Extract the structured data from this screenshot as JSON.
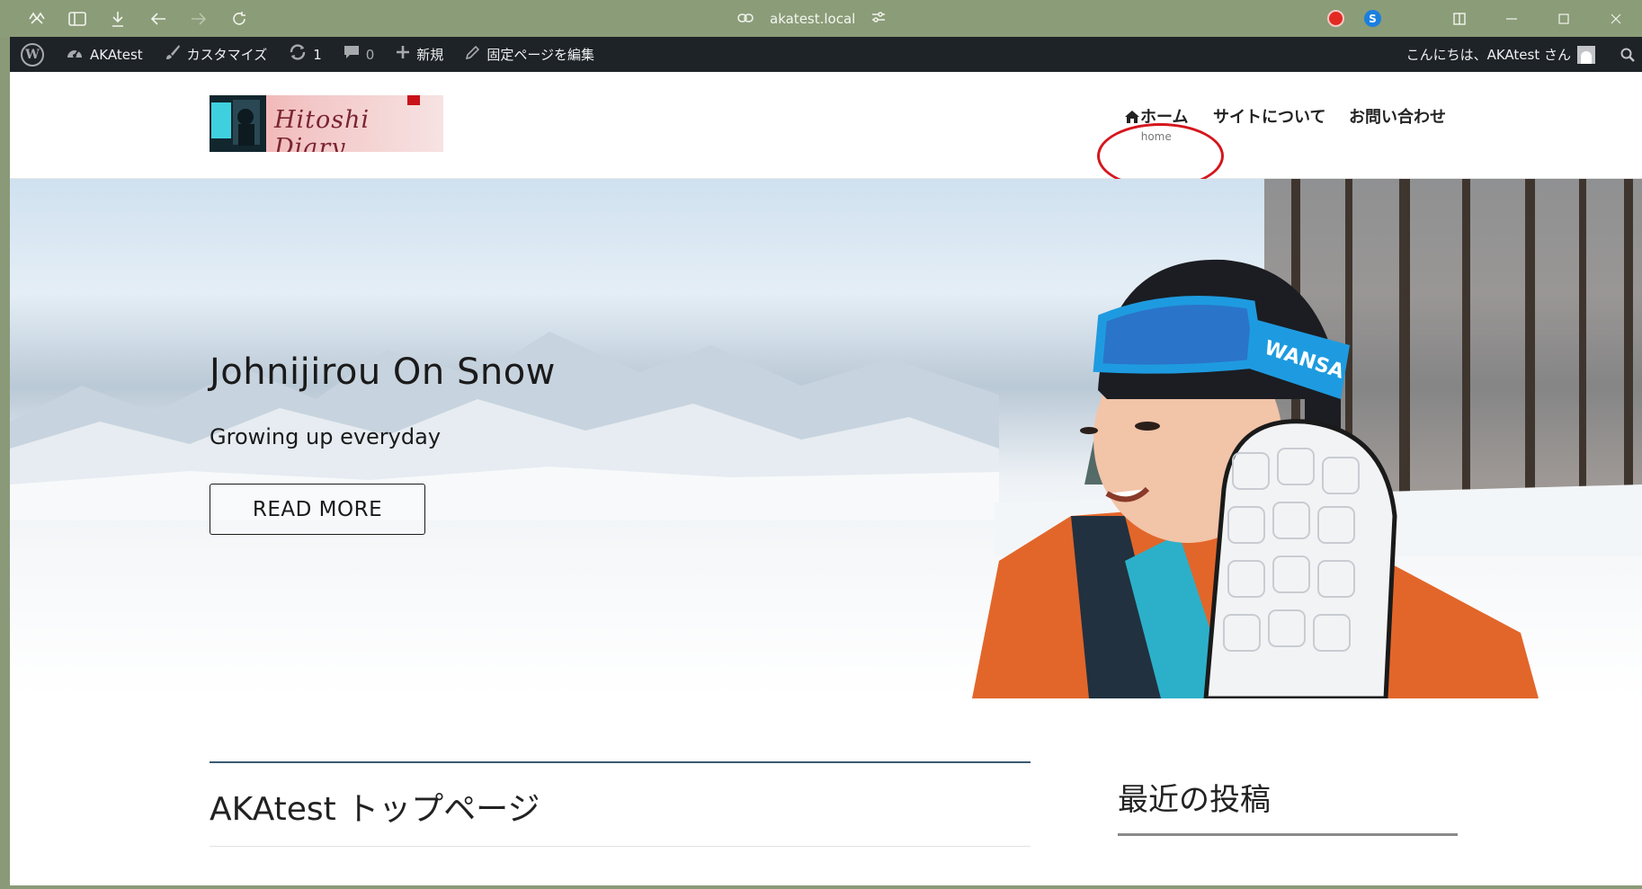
{
  "browser": {
    "url": "akatest.local"
  },
  "adminbar": {
    "site_name": "AKAtest",
    "customize": "カスタマイズ",
    "updates_count": "1",
    "comments_count": "0",
    "new_label": "新規",
    "edit_page": "固定ページを編集",
    "greeting": "こんにちは、AKAtest さん"
  },
  "header": {
    "logo_text": "Hitoshi Diary",
    "nav": [
      {
        "label": "ホーム",
        "sub": "home"
      },
      {
        "label": "サイトについて"
      },
      {
        "label": "お問い合わせ"
      }
    ]
  },
  "hero": {
    "title": "Johnijirou On Snow",
    "subtitle": "Growing up everyday",
    "button": "READ MORE",
    "goggle_text": "WANSA"
  },
  "content": {
    "page_title": "AKAtest トップページ",
    "widget_title": "最近の投稿"
  },
  "colors": {
    "chrome": "#8b9c78",
    "adminbar": "#1d2327",
    "highlight_circle": "#d5161d"
  }
}
